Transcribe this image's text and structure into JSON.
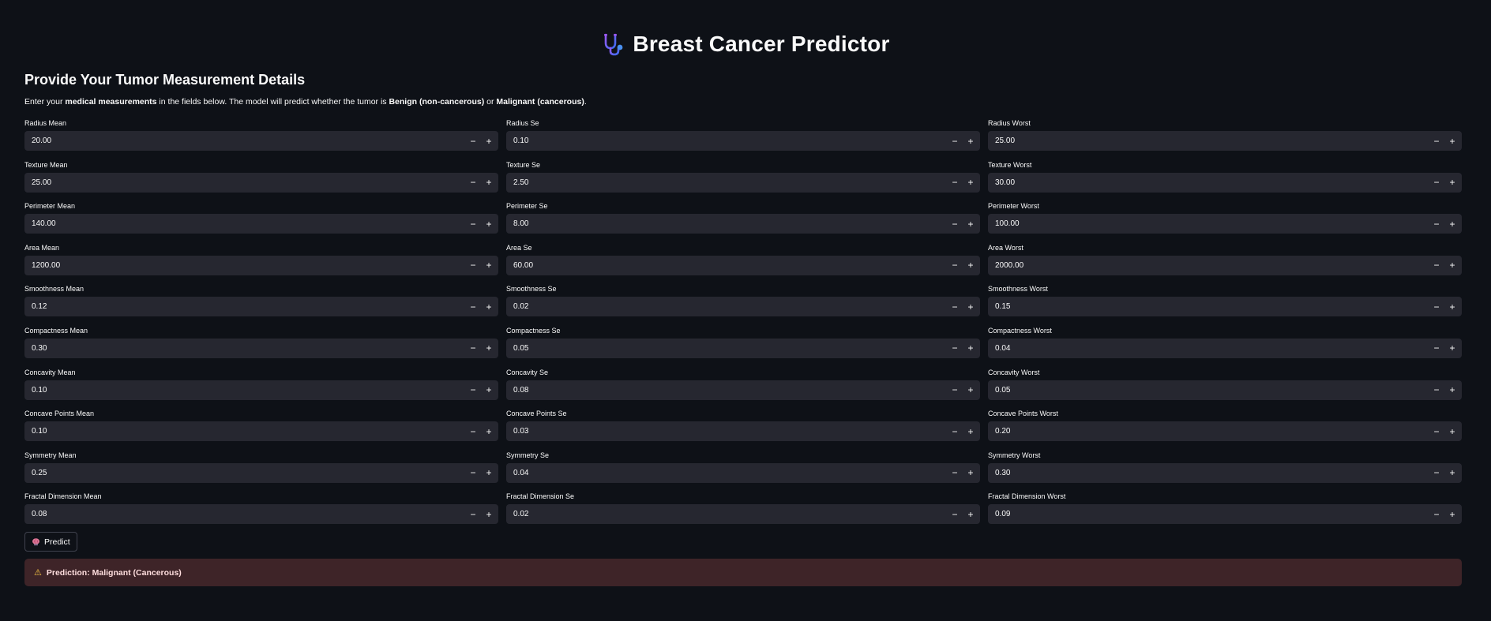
{
  "header": {
    "title": "Breast Cancer Predictor",
    "icon": "stethoscope-icon"
  },
  "form": {
    "heading": "Provide Your Tumor Measurement Details",
    "intro": {
      "p1": "Enter your ",
      "b1": "medical measurements",
      "p2": " in the fields below. The model will predict whether the tumor is ",
      "b2": "Benign (non-cancerous)",
      "p3": " or ",
      "b3": "Malignant (cancerous)",
      "p4": "."
    },
    "fields": [
      {
        "label": "Radius Mean",
        "value": "20.00"
      },
      {
        "label": "Radius Se",
        "value": "0.10"
      },
      {
        "label": "Radius Worst",
        "value": "25.00"
      },
      {
        "label": "Texture Mean",
        "value": "25.00"
      },
      {
        "label": "Texture Se",
        "value": "2.50"
      },
      {
        "label": "Texture Worst",
        "value": "30.00"
      },
      {
        "label": "Perimeter Mean",
        "value": "140.00"
      },
      {
        "label": "Perimeter Se",
        "value": "8.00"
      },
      {
        "label": "Perimeter Worst",
        "value": "100.00"
      },
      {
        "label": "Area Mean",
        "value": "1200.00"
      },
      {
        "label": "Area Se",
        "value": "60.00"
      },
      {
        "label": "Area Worst",
        "value": "2000.00"
      },
      {
        "label": "Smoothness Mean",
        "value": "0.12"
      },
      {
        "label": "Smoothness Se",
        "value": "0.02"
      },
      {
        "label": "Smoothness Worst",
        "value": "0.15"
      },
      {
        "label": "Compactness Mean",
        "value": "0.30"
      },
      {
        "label": "Compactness Se",
        "value": "0.05"
      },
      {
        "label": "Compactness Worst",
        "value": "0.04"
      },
      {
        "label": "Concavity Mean",
        "value": "0.10"
      },
      {
        "label": "Concavity Se",
        "value": "0.08"
      },
      {
        "label": "Concavity Worst",
        "value": "0.05"
      },
      {
        "label": "Concave Points Mean",
        "value": "0.10"
      },
      {
        "label": "Concave Points Se",
        "value": "0.03"
      },
      {
        "label": "Concave Points Worst",
        "value": "0.20"
      },
      {
        "label": "Symmetry Mean",
        "value": "0.25"
      },
      {
        "label": "Symmetry Se",
        "value": "0.04"
      },
      {
        "label": "Symmetry Worst",
        "value": "0.30"
      },
      {
        "label": "Fractal Dimension Mean",
        "value": "0.08"
      },
      {
        "label": "Fractal Dimension Se",
        "value": "0.02"
      },
      {
        "label": "Fractal Dimension Worst",
        "value": "0.09"
      }
    ],
    "stepper": {
      "minus": "−",
      "plus": "+"
    },
    "predict_button": {
      "label": "Predict",
      "icon": "brain-icon"
    }
  },
  "result": {
    "icon": "warning-icon",
    "text": "Prediction: Malignant (Cancerous)"
  },
  "colors": {
    "background": "#0e1117",
    "input_bg": "#262730",
    "alert_bg": "#3e2428",
    "warning": "#f6c343"
  }
}
